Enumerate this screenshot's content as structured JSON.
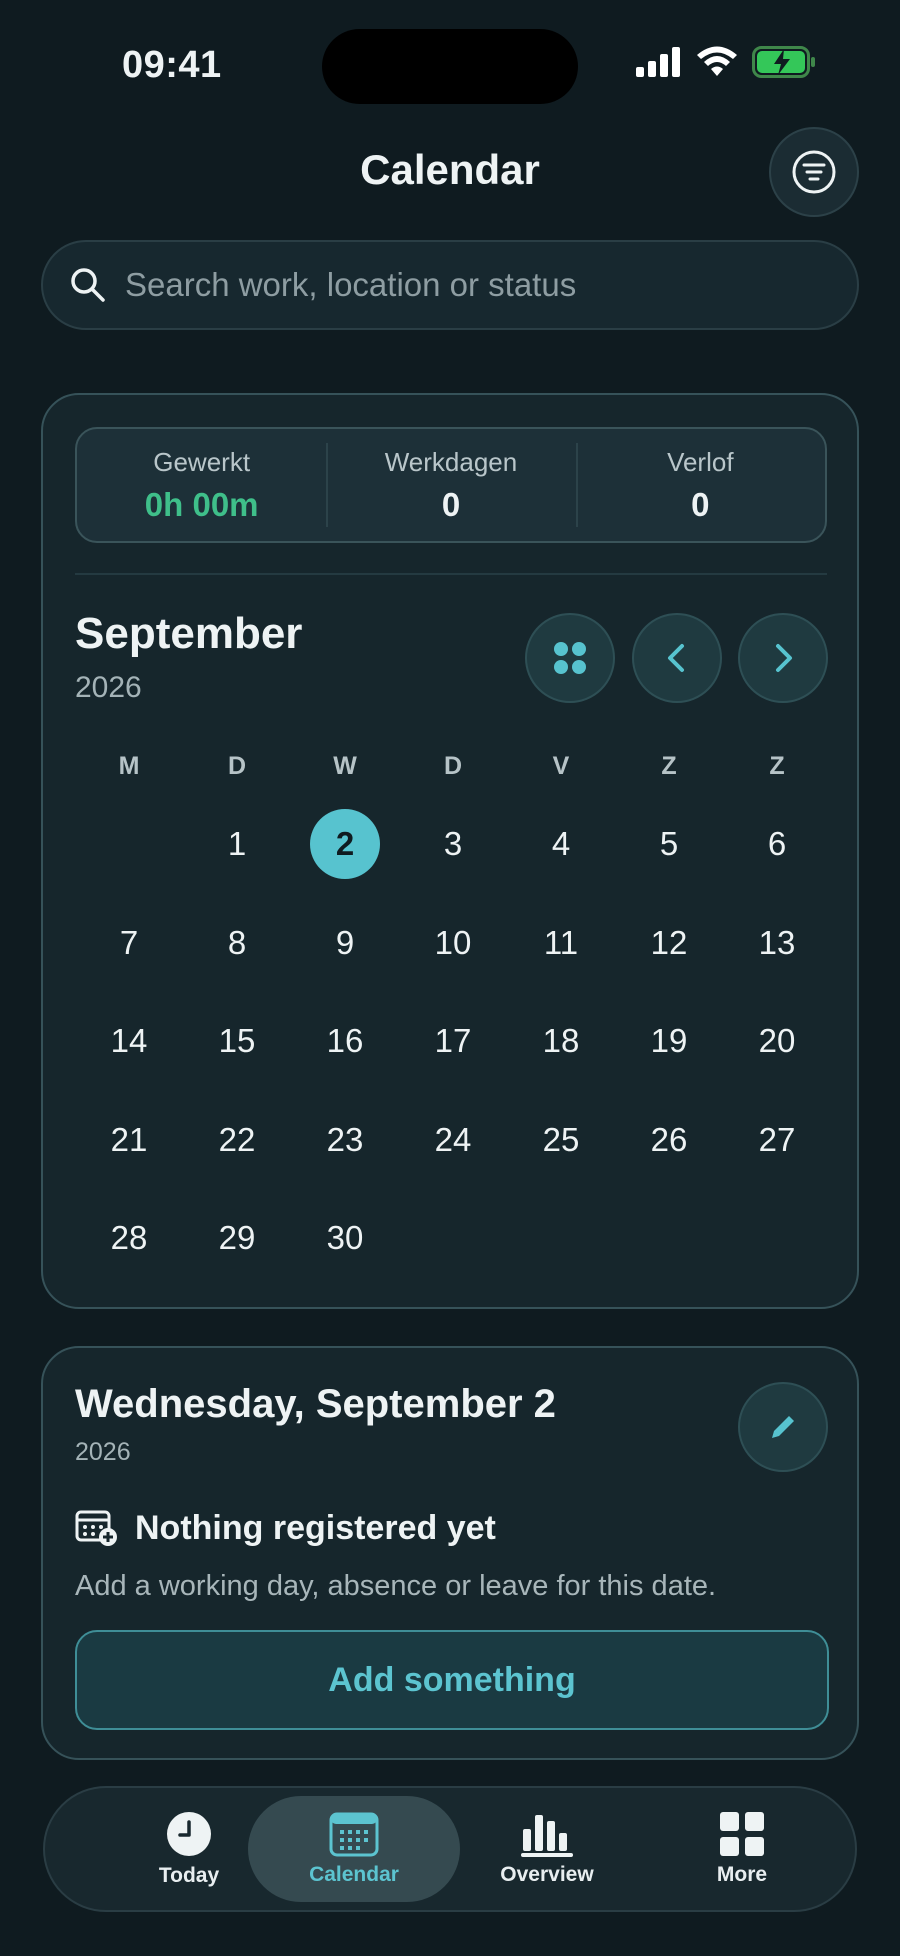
{
  "status": {
    "time": "09:41"
  },
  "header": {
    "title": "Calendar"
  },
  "search": {
    "placeholder": "Search work, location or status"
  },
  "stats": [
    {
      "label": "Gewerkt",
      "value": "0h 00m"
    },
    {
      "label": "Werkdagen",
      "value": "0"
    },
    {
      "label": "Verlof",
      "value": "0"
    }
  ],
  "calendar": {
    "month": "September",
    "year": "2026",
    "weekdays": [
      "M",
      "D",
      "W",
      "D",
      "V",
      "Z",
      "Z"
    ],
    "selected_day": "2",
    "days": [
      "",
      "1",
      "2",
      "3",
      "4",
      "5",
      "6",
      "7",
      "8",
      "9",
      "10",
      "11",
      "12",
      "13",
      "14",
      "15",
      "16",
      "17",
      "18",
      "19",
      "20",
      "21",
      "22",
      "23",
      "24",
      "25",
      "26",
      "27",
      "28",
      "29",
      "30",
      "",
      "",
      "",
      ""
    ]
  },
  "detail": {
    "title": "Wednesday, September 2",
    "year": "2026",
    "empty_title": "Nothing registered yet",
    "empty_desc": "Add a working day, absence or leave for this date.",
    "add_label": "Add something"
  },
  "tabs": [
    {
      "label": "Today",
      "icon": "clock-icon"
    },
    {
      "label": "Calendar",
      "icon": "calendar-icon",
      "active": true
    },
    {
      "label": "Overview",
      "icon": "bar-chart-icon"
    },
    {
      "label": "More",
      "icon": "grid-icon"
    }
  ],
  "colors": {
    "accent": "#57c3cf",
    "positive": "#3fbf8a",
    "background": "#0f1b20"
  }
}
